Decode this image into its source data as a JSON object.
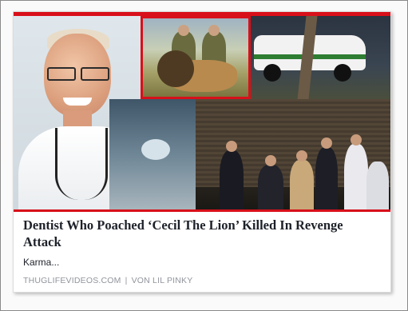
{
  "link_preview": {
    "headline": "Dentist Who Poached ‘Cecil The Lion’ Killed In Revenge Attack",
    "description": "Karma...",
    "source_domain": "THUGLIFEVIDEOS.COM",
    "separator": "|",
    "author": "VON LIL PINKY"
  },
  "colors": {
    "accent_red": "#d8101a",
    "headline_text": "#1d2129",
    "meta_text": "#90949c"
  },
  "image": {
    "panels": [
      "dentist-portrait",
      "hunters-with-lion",
      "border-patrol-vehicle",
      "dental-clinic",
      "night-crime-scene"
    ]
  }
}
